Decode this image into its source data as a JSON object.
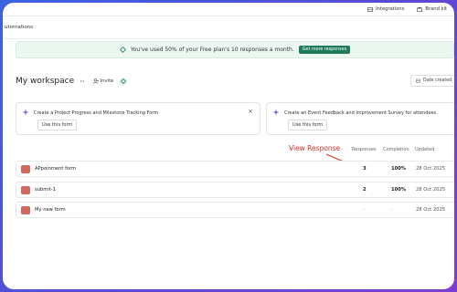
{
  "topbar": {
    "integrations": "Integrations",
    "brand_kit": "Brand kit"
  },
  "secondary_nav": {
    "label": "utomations"
  },
  "banner": {
    "message": "You've used 50% of your Free plan's 10 responses a month.",
    "button": "Get more responses"
  },
  "workspace": {
    "title": "My workspace",
    "more": "···",
    "invite": "Invite",
    "sort": "Date created"
  },
  "suggestions": [
    {
      "title": "Create a Project Progress and Milestone Tracking Form",
      "button": "Use this form",
      "close": "×"
    },
    {
      "title": "Create an Event Feedback and Improvement Survey for attendees.",
      "button": "Use this form"
    }
  ],
  "annotation": {
    "text": "View Response",
    "color": "#d8302a"
  },
  "table": {
    "headers": {
      "responses": "Responses",
      "completion": "Completion",
      "updated": "Updated"
    },
    "rows": [
      {
        "name": "APpoinment form",
        "responses": "3",
        "completion": "100%",
        "updated": "28 Oct 2025"
      },
      {
        "name": "submit-1",
        "responses": "2",
        "completion": "100%",
        "updated": "28 Oct 2025"
      },
      {
        "name": "My new form",
        "responses": "-",
        "completion": "-",
        "updated": "28 Oct 2025"
      }
    ]
  },
  "colors": {
    "accent_green": "#1f7a5a",
    "banner_bg": "#edf7f2",
    "form_icon": "#d16a5e",
    "frame_gradient_start": "#3b63e0",
    "frame_gradient_end": "#7b3fd0"
  },
  "icons": {
    "integrations": "integrations-icon",
    "brand_kit": "brand-kit-icon",
    "banner": "diamond-icon",
    "invite": "user-plus-icon",
    "tag": "tag-icon",
    "sort": "calendar-icon",
    "suggestion": "sparkle-icon",
    "close": "close-icon",
    "more": "more-dots-icon"
  }
}
